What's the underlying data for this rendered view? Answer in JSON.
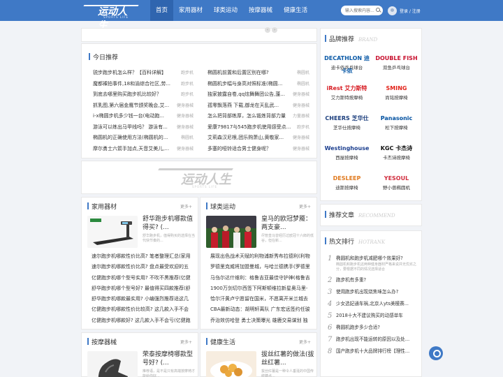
{
  "header": {
    "logo_text": "运动人生",
    "logo_sub": "SPORTS LIFE",
    "nav": [
      "首页",
      "家用器材",
      "球类运动",
      "按摩器械",
      "健康生活"
    ],
    "search_placeholder": "输入搜索内容...",
    "login": "登录 / 注册"
  },
  "today": {
    "title": "今日推荐",
    "left": [
      {
        "t": "锐步跑步机怎么样？【百科详解】",
        "c": "跑步机"
      },
      {
        "t": "魔都裸拍事件,18和渝综合社区,劳...",
        "c": "跑步机"
      },
      {
        "t": "到底去哪里购买跑步机比较好？",
        "c": "跑步机"
      },
      {
        "t": "抓乳图,第六届金鹰节颁奖晚会,艾...",
        "c": "健身器械"
      },
      {
        "t": "i-x椭圆步机多少钱一台(电动跑...",
        "c": "健身器械"
      },
      {
        "t": "游泳可以练出马甲线吗？ 游泳有...",
        "c": "健身器械"
      },
      {
        "t": "椭圆机的正确使用方法(椭圆机的...",
        "c": "椭圆机"
      },
      {
        "t": "摩尔勇士六箭手加点,天音艾美儿,...",
        "c": "健身器械"
      }
    ],
    "right": [
      {
        "t": "椭圆机前置和后置区别在哪?",
        "c": "椭圆机"
      },
      {
        "t": "椭圆机步幅与身高对照标准(椭圆...",
        "c": "椭圆机"
      },
      {
        "t": "独家披露自卷,qq炫舞舞团公告,蓬...",
        "c": "健身器械"
      },
      {
        "t": "孤零飘落燕 下载,御龙在天乱武...",
        "c": "健身器械"
      },
      {
        "t": "怎么把背部练厚，怎么锻炼背部力量",
        "c": "力量器械"
      },
      {
        "t": "爱康79817与545跑步机使用感受点...",
        "c": "跑步机"
      },
      {
        "t": "艾莉森汉尼根,团乐购萧山,黄敬家...",
        "c": "健身器械"
      },
      {
        "t": "多塞的哑铃适合男士健身呢？",
        "c": "健身器械"
      }
    ]
  },
  "banner": {
    "logo_text": "运动人生",
    "logo_sub": "SPORTS LIFE"
  },
  "categories": [
    {
      "title": "家用器材",
      "more": "更多+",
      "feature_title": "舒华跑步机哪款值得买? (...",
      "feature_desc": "舒华跑步机，值得购买的选择在当代快节奏的...",
      "items": [
        "速尔跑步机哪款性价比高? 笔者整理汇总(家用",
        "速尔跑步机哪款性价比高? 盘点最受欢迎的五",
        "亿健跑步机哪个型号实用? 不吹不黑推荐(亿健",
        "舒华跑步机哪个型号好? 最值得买四款推荐(舒",
        "舒华跑步机哪款最实用? 小编强烈推荐适这几",
        "亿健跑步机哪款性价比较高? 这几款入手不会",
        "亿健跑步机哪款好? 这几款入手不会亏(亿健跑"
      ]
    },
    {
      "title": "球类运动",
      "more": "更多+",
      "feature_title": "皇马的欧冠梦魇：两支豪...",
      "feature_desc": "尽管皇马曾经历过欧冠十六郎的低谷，但在新...",
      "items": [
        "展现出色战术天赋的利物浦新秀布拉德利(利物",
        "罗德里克威将加盟曼城，与哈兰德携手(罗德里",
        "马刍尔达什维利：格鲁吉亚最佳守护神(格鲁吉",
        "1900万剑切尔西签下阿斯顿维拉新星奥马里-",
        "恰尔汗黄卢宁愿留在国米，不愿离开米兰城去",
        "CBA最新动态：胡明轩离队 广东宏远签约任骏",
        "乔治效仿哈登 勇士决策曝光 雄鹿交易谋划 独"
      ]
    },
    {
      "title": "按摩器械",
      "more": "更多+",
      "feature_title": "荣泰按摩椅哪款型号好? (...",
      "feature_desc": "推荐语，是不是只有高端按摩椅才能给你好...",
      "items": []
    },
    {
      "title": "健康生活",
      "more": "更多+",
      "feature_title": "拔丝红薯的做法(拔丝红薯...",
      "feature_desc": "拔丝红薯是一种令人垂涎的中国传统糖点...",
      "items": []
    }
  ],
  "side": {
    "brand_title": "品牌推荐",
    "brand_en": "BRAND",
    "brands": [
      {
        "logo": "DECATHLON 迪卡侬",
        "name": "迪卡侬乒乓球台",
        "color": "#0b5aa7"
      },
      {
        "logo": "DOUBLE FISH",
        "name": "双鱼乒乓球台",
        "color": "#c8102e"
      },
      {
        "logo": "iRest 艾力斯特",
        "name": "艾力斯特按摩椅",
        "color": "#d71920"
      },
      {
        "logo": "SMING",
        "name": "尚铭按摩椅",
        "color": "#e2231a"
      },
      {
        "logo": "CHEERS 芝华仕",
        "name": "芝华仕按摩椅",
        "color": "#1a3d7c"
      },
      {
        "logo": "Panasonic",
        "name": "松下按摩椅",
        "color": "#0050a0"
      },
      {
        "logo": "Westinghouse",
        "name": "西屋按摩椅",
        "color": "#1c3f8f"
      },
      {
        "logo": "KGC 卡杰诗",
        "name": "卡杰诗按摩椅",
        "color": "#111111"
      },
      {
        "logo": "DESLEEP",
        "name": "迪斯按摩椅",
        "color": "#e07a1f"
      },
      {
        "logo": "YESOUL",
        "name": "野小兽椭圆机",
        "color": "#d12e3f"
      }
    ],
    "recommend_title": "推荐文章",
    "recommend_en": "RECOMMEND",
    "hot_title": "热文排行",
    "hot_en": "HOTRANK",
    "hot": [
      {
        "n": "1",
        "t": "椭圆机和跑步机减肥哪个效果好?",
        "d": "椭圆机和跑步机这两种健身器材严格来说并无优劣之分，要根据不同的情况选择适合"
      },
      {
        "n": "2",
        "t": "跑步机有多重?",
        "d": ""
      },
      {
        "n": "3",
        "t": "使用跑步机出现烧焦味怎么办?",
        "d": ""
      },
      {
        "n": "4",
        "t": "少女选妃通车祸,北京人yts美模赛...",
        "d": ""
      },
      {
        "n": "5",
        "t": "2018十大不建议购买的动感单车",
        "d": ""
      },
      {
        "n": "6",
        "t": "椭圆机跑步多少合适?",
        "d": ""
      },
      {
        "n": "7",
        "t": "跑步机出现不能运转的原因以及处...",
        "d": ""
      },
      {
        "n": "8",
        "t": "国产跑步机十大品牌排行榜【理性...",
        "d": ""
      }
    ]
  }
}
